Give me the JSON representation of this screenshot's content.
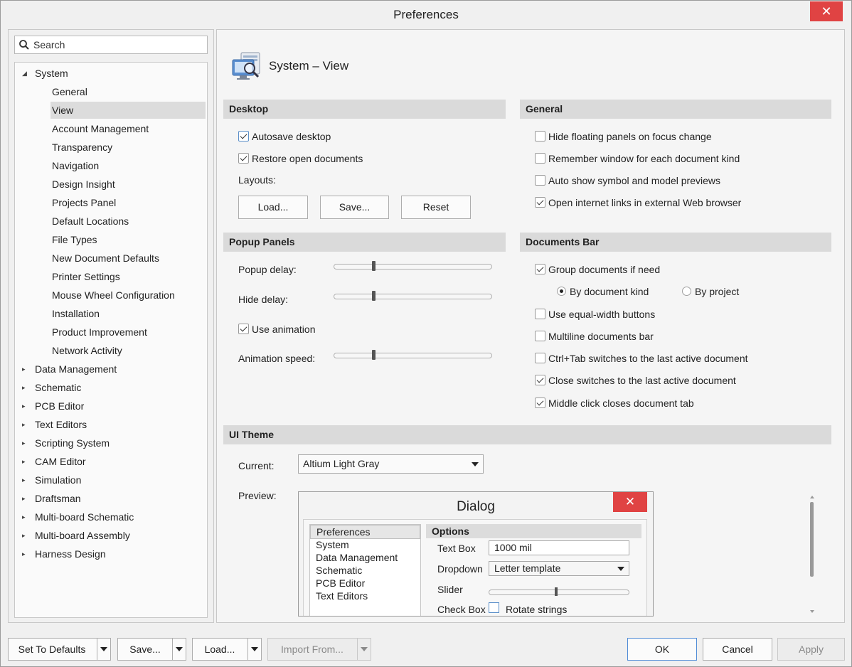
{
  "window": {
    "title": "Preferences",
    "close_glyph": "✕"
  },
  "search": {
    "placeholder": "Search",
    "value": ""
  },
  "tree": {
    "system": "System",
    "children": [
      "General",
      "View",
      "Account Management",
      "Transparency",
      "Navigation",
      "Design Insight",
      "Projects Panel",
      "Default Locations",
      "File Types",
      "New Document Defaults",
      "Printer Settings",
      "Mouse Wheel Configuration",
      "Installation",
      "Product Improvement",
      "Network Activity"
    ],
    "selected": "View",
    "roots": [
      "Data Management",
      "Schematic",
      "PCB Editor",
      "Text Editors",
      "Scripting System",
      "CAM Editor",
      "Simulation",
      "Draftsman",
      "Multi-board Schematic",
      "Multi-board Assembly",
      "Harness Design"
    ]
  },
  "page": {
    "title": "System – View"
  },
  "desktop": {
    "header": "Desktop",
    "autosave": {
      "label": "Autosave desktop",
      "checked": true
    },
    "restore": {
      "label": "Restore open documents",
      "checked": true
    },
    "layouts_label": "Layouts:",
    "load": "Load...",
    "save": "Save...",
    "reset": "Reset"
  },
  "general": {
    "header": "General",
    "items": [
      {
        "label": "Hide floating panels on focus change",
        "checked": false
      },
      {
        "label": "Remember window for each document kind",
        "checked": false
      },
      {
        "label": "Auto show symbol and model previews",
        "checked": false
      },
      {
        "label": "Open internet links in external Web browser",
        "checked": true
      }
    ]
  },
  "popup": {
    "header": "Popup Panels",
    "popup_delay": "Popup delay:",
    "hide_delay": "Hide delay:",
    "use_animation": {
      "label": "Use animation",
      "checked": true
    },
    "animation_speed": "Animation speed:",
    "slider_levels": {
      "popup_delay": 0.25,
      "hide_delay": 0.25,
      "animation_speed": 0.25
    }
  },
  "docbar": {
    "header": "Documents Bar",
    "group": {
      "label": "Group documents if need",
      "checked": true
    },
    "by_kind": {
      "label": "By document kind",
      "selected": true
    },
    "by_project": {
      "label": "By project",
      "selected": false
    },
    "items": [
      {
        "label": "Use equal-width buttons",
        "checked": false
      },
      {
        "label": "Multiline documents bar",
        "checked": false
      },
      {
        "label": "Ctrl+Tab switches to the last active document",
        "checked": false
      },
      {
        "label": "Close switches to the last active document",
        "checked": true
      },
      {
        "label": "Middle click closes document tab",
        "checked": true
      }
    ]
  },
  "theme": {
    "header": "UI Theme",
    "current_label": "Current:",
    "current_value": "Altium Light Gray",
    "preview_label": "Preview:"
  },
  "preview": {
    "title": "Dialog",
    "close_glyph": "✕",
    "list": [
      "Preferences",
      "System",
      "Data Management",
      "Schematic",
      "PCB Editor",
      "Text Editors"
    ],
    "options_header": "Options",
    "text_box_label": "Text Box",
    "text_box_value": "1000 mil",
    "dropdown_label": "Dropdown",
    "dropdown_value": "Letter template",
    "slider_label": "Slider",
    "checkbox_label": "Check Box",
    "checkbox_text": "Rotate strings"
  },
  "footer": {
    "set_defaults": "Set To Defaults",
    "save": "Save...",
    "load": "Load...",
    "import": "Import From...",
    "ok": "OK",
    "cancel": "Cancel",
    "apply": "Apply"
  }
}
